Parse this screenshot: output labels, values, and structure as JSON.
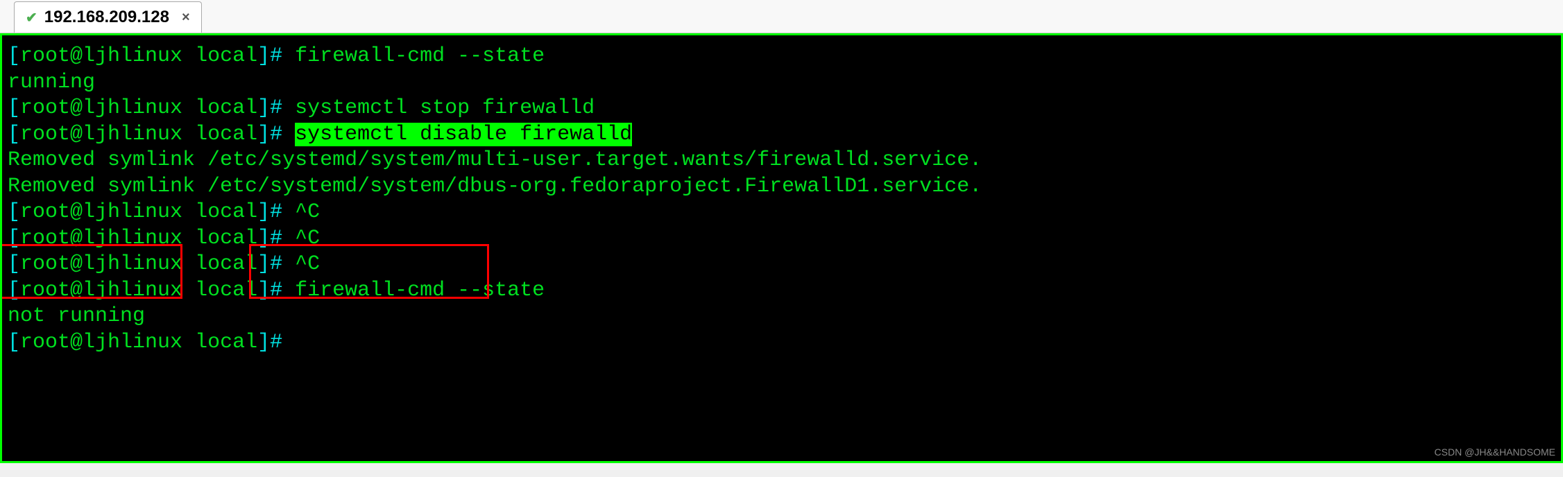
{
  "tab": {
    "title": "192.168.209.128",
    "icon": "✔",
    "close": "×"
  },
  "terminal": {
    "lines": [
      {
        "prompt": "[root@ljhlinux local]# ",
        "cmd": "firewall-cmd --state",
        "highlighted": false
      },
      {
        "output": "running"
      },
      {
        "prompt": "[root@ljhlinux local]# ",
        "cmd": "systemctl stop firewalld",
        "highlighted": false
      },
      {
        "prompt": "[root@ljhlinux local]# ",
        "cmd": "systemctl disable firewalld",
        "highlighted": true
      },
      {
        "output": "Removed symlink /etc/systemd/system/multi-user.target.wants/firewalld.service."
      },
      {
        "output": "Removed symlink /etc/systemd/system/dbus-org.fedoraproject.FirewallD1.service."
      },
      {
        "prompt": "[root@ljhlinux local]# ",
        "cmd": "^C",
        "highlighted": false
      },
      {
        "prompt": "[root@ljhlinux local]# ",
        "cmd": "^C",
        "highlighted": false
      },
      {
        "prompt": "[root@ljhlinux local]# ",
        "cmd": "^C",
        "highlighted": false
      },
      {
        "prompt": "[root@ljhlinux local]# ",
        "cmd": "firewall-cmd --state",
        "highlighted": false
      },
      {
        "output": "not running"
      },
      {
        "prompt": "[root@ljhlinux local]# ",
        "cmd": "",
        "highlighted": false
      }
    ]
  },
  "prompt_parts": {
    "open": "[",
    "userhost": "root@ljhlinux",
    "space": " ",
    "path": "local",
    "close": "]# "
  },
  "watermark": "CSDN @JH&&HANDSOME"
}
